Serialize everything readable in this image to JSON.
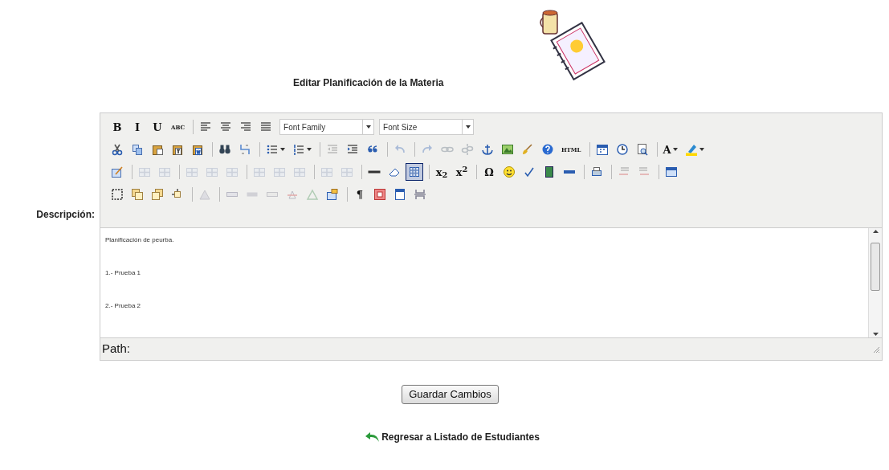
{
  "page": {
    "title": "Editar Planificación de la Materia"
  },
  "form": {
    "label": "Descripción:",
    "toolbar_rows": [
      [
        {
          "kind": "glyph",
          "label": "B",
          "disabled": false,
          "selected": false
        },
        {
          "kind": "glyph",
          "label": "I",
          "disabled": false,
          "selected": false
        },
        {
          "kind": "glyph",
          "label": "U",
          "disabled": false,
          "selected": false
        },
        {
          "kind": "glyph",
          "label": "ABC",
          "disabled": false,
          "selected": false
        },
        {
          "kind": "separator"
        },
        {
          "kind": "icon",
          "disabled": false,
          "selected": false
        },
        {
          "kind": "icon",
          "disabled": false,
          "selected": false
        },
        {
          "kind": "icon",
          "disabled": false,
          "selected": false
        },
        {
          "kind": "icon",
          "disabled": false,
          "selected": false
        },
        {
          "kind": "select",
          "label": "Font Family"
        },
        {
          "kind": "select",
          "label": "Font Size"
        }
      ],
      [
        {
          "kind": "icon",
          "disabled": false,
          "selected": false
        },
        {
          "kind": "icon",
          "disabled": false,
          "selected": false
        },
        {
          "kind": "icon",
          "disabled": false,
          "selected": false
        },
        {
          "kind": "icon",
          "disabled": false,
          "selected": false
        },
        {
          "kind": "icon",
          "disabled": false,
          "selected": false
        },
        {
          "kind": "separator"
        },
        {
          "kind": "icon",
          "disabled": false,
          "selected": false
        },
        {
          "kind": "icon",
          "disabled": false,
          "selected": false
        },
        {
          "kind": "separator"
        },
        {
          "kind": "split",
          "disabled": false,
          "selected": false
        },
        {
          "kind": "split",
          "disabled": false,
          "selected": false
        },
        {
          "kind": "separator"
        },
        {
          "kind": "icon",
          "disabled": true,
          "selected": false
        },
        {
          "kind": "icon",
          "disabled": false,
          "selected": false
        },
        {
          "kind": "icon",
          "disabled": false,
          "selected": false
        },
        {
          "kind": "separator"
        },
        {
          "kind": "icon",
          "disabled": true,
          "selected": false
        },
        {
          "kind": "separator"
        },
        {
          "kind": "icon",
          "disabled": true,
          "selected": false
        },
        {
          "kind": "icon",
          "disabled": true,
          "selected": false
        },
        {
          "kind": "icon",
          "disabled": true,
          "selected": false
        },
        {
          "kind": "icon",
          "disabled": false,
          "selected": false
        },
        {
          "kind": "icon",
          "disabled": false,
          "selected": false
        },
        {
          "kind": "icon",
          "disabled": false,
          "selected": false
        },
        {
          "kind": "icon",
          "disabled": false,
          "selected": false
        },
        {
          "kind": "glyph",
          "label": "HTML",
          "disabled": false,
          "selected": false
        },
        {
          "kind": "separator"
        },
        {
          "kind": "icon",
          "disabled": false,
          "selected": false
        },
        {
          "kind": "icon",
          "disabled": false,
          "selected": false
        },
        {
          "kind": "icon",
          "disabled": false,
          "selected": false
        },
        {
          "kind": "separator"
        },
        {
          "kind": "split",
          "label": "A",
          "disabled": false,
          "selected": false
        },
        {
          "kind": "split",
          "disabled": false,
          "selected": false
        }
      ],
      [
        {
          "kind": "icon",
          "disabled": false,
          "selected": false
        },
        {
          "kind": "separator"
        },
        {
          "kind": "icon",
          "disabled": true,
          "selected": false
        },
        {
          "kind": "icon",
          "disabled": true,
          "selected": false
        },
        {
          "kind": "separator"
        },
        {
          "kind": "icon",
          "disabled": true,
          "selected": false
        },
        {
          "kind": "icon",
          "disabled": true,
          "selected": false
        },
        {
          "kind": "icon",
          "disabled": true,
          "selected": false
        },
        {
          "kind": "separator"
        },
        {
          "kind": "icon",
          "disabled": true,
          "selected": false
        },
        {
          "kind": "icon",
          "disabled": true,
          "selected": false
        },
        {
          "kind": "icon",
          "disabled": true,
          "selected": false
        },
        {
          "kind": "separator"
        },
        {
          "kind": "icon",
          "disabled": true,
          "selected": false
        },
        {
          "kind": "icon",
          "disabled": true,
          "selected": false
        },
        {
          "kind": "separator"
        },
        {
          "kind": "icon",
          "disabled": false,
          "selected": false
        },
        {
          "kind": "icon",
          "disabled": false,
          "selected": false
        },
        {
          "kind": "icon",
          "disabled": false,
          "selected": true
        },
        {
          "kind": "separator"
        },
        {
          "kind": "glyph",
          "label": "x$_{2}$",
          "disabled": false,
          "selected": false
        },
        {
          "kind": "glyph",
          "label": "x$^{2}$",
          "disabled": false,
          "selected": false
        },
        {
          "kind": "separator"
        },
        {
          "kind": "glyph",
          "label": "Ω",
          "disabled": false,
          "selected": false
        },
        {
          "kind": "icon",
          "disabled": false,
          "selected": false
        },
        {
          "kind": "icon",
          "disabled": false,
          "selected": false
        },
        {
          "kind": "icon",
          "disabled": false,
          "selected": false
        },
        {
          "kind": "icon",
          "disabled": false,
          "selected": false
        },
        {
          "kind": "separator"
        },
        {
          "kind": "icon",
          "disabled": false,
          "selected": false
        },
        {
          "kind": "separator"
        },
        {
          "kind": "icon",
          "disabled": true,
          "selected": false
        },
        {
          "kind": "icon",
          "disabled": true,
          "selected": false
        },
        {
          "kind": "separator"
        },
        {
          "kind": "icon",
          "disabled": false,
          "selected": false
        }
      ],
      [
        {
          "kind": "icon",
          "disabled": false,
          "selected": false
        },
        {
          "kind": "icon",
          "disabled": false,
          "selected": false
        },
        {
          "kind": "icon",
          "disabled": false,
          "selected": false
        },
        {
          "kind": "icon",
          "disabled": false,
          "selected": false
        },
        {
          "kind": "separator"
        },
        {
          "kind": "icon",
          "disabled": true,
          "selected": false
        },
        {
          "kind": "separator"
        },
        {
          "kind": "icon",
          "disabled": true,
          "selected": false
        },
        {
          "kind": "icon",
          "disabled": true,
          "selected": false
        },
        {
          "kind": "icon",
          "disabled": true,
          "selected": false
        },
        {
          "kind": "icon",
          "disabled": true,
          "selected": false
        },
        {
          "kind": "icon",
          "disabled": true,
          "selected": false
        },
        {
          "kind": "icon",
          "disabled": false,
          "selected": false
        },
        {
          "kind": "separator"
        },
        {
          "kind": "glyph",
          "label": "¶",
          "disabled": false,
          "selected": false
        },
        {
          "kind": "icon",
          "disabled": false,
          "selected": false
        },
        {
          "kind": "icon",
          "disabled": false,
          "selected": false
        },
        {
          "kind": "icon",
          "disabled": false,
          "selected": false
        }
      ]
    ],
    "content": [
      "Planificación de peurba.",
      "1.- Prueba 1",
      "2.- Prueba 2"
    ],
    "path_label": "Path:"
  },
  "save_button": "Guardar Cambios",
  "back_link": "Regresar a Listado de Estudiantes"
}
